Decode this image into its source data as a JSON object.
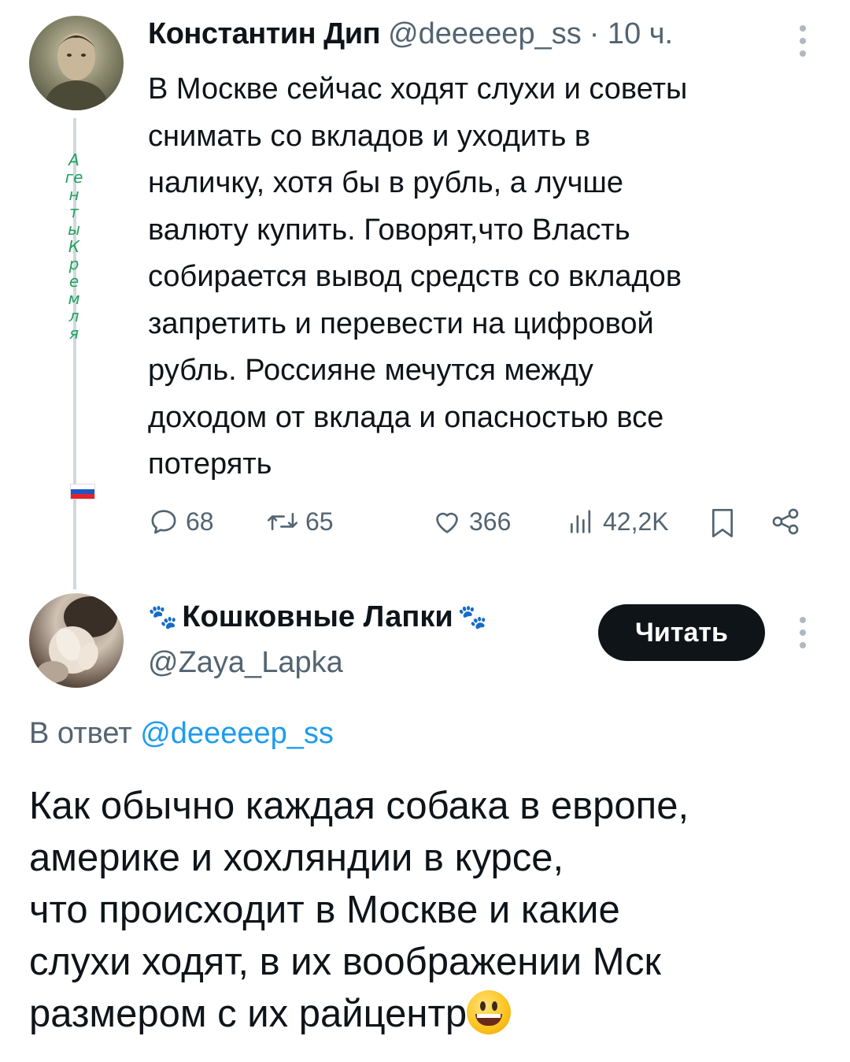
{
  "tweet": {
    "author_name": "Константин Дип",
    "author_handle": "@deeeeep_ss",
    "time": "· 10 ч.",
    "bio_vertical": "Агенты Кремля",
    "text": "В Москве сейчас  ходят слухи и советы\nснимать со вкладов и уходить в\nналичку, хотя бы в рубль, а лучше\nвалюту купить. Говорят,что Власть\nсобирается вывод средств со вкладов\nзапретить и перевести на цифровой\nрубль. Россияне мечутся между\nдоходом от вклада и опасностью все\nпотерять",
    "stats": {
      "replies": "68",
      "retweets": "65",
      "likes": "366",
      "views": "42,2K"
    },
    "icons": [
      "reply-icon",
      "retweet-icon",
      "like-icon",
      "views-icon",
      "bookmark-icon",
      "share-icon"
    ]
  },
  "reply": {
    "author_name": "Кошковные Лапки",
    "author_handle": "@Zaya_Lapka",
    "follow_label": "Читать",
    "reply_prefix": "В ответ",
    "reply_to_handle": "@deeeeep_ss",
    "text": "Как обычно каждая собака в европе,\nамерике и хохляндии в курсе,\nчто происходит в Москве и какие\nслухи ходят, в их воображении Мск\nразмером с их райцентр",
    "trailing_emoji": "grinning-face"
  },
  "colors": {
    "link": "#1d9bf0",
    "muted": "#536471",
    "text": "#0f1419",
    "bio_green": "#22a060",
    "follow_button_bg": "#0f1419"
  }
}
